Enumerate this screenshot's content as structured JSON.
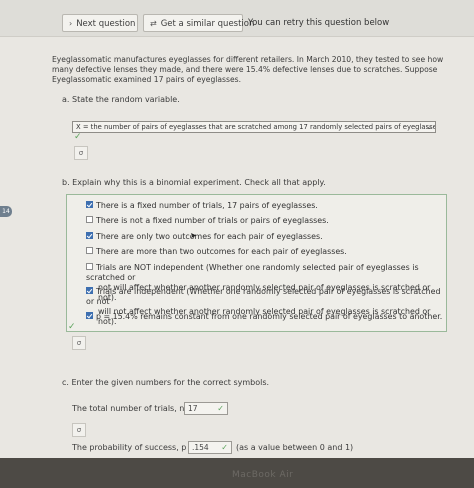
{
  "toolbar": {
    "next_label": "Next question",
    "similar_label": "Get a similar question",
    "retry_text": "You can retry this question below"
  },
  "question": {
    "intro": "Eyeglassomatic manufactures eyeglasses for different retailers. In March 2010, they tested to see how many defective lenses they made, and there were 15.4% defective lenses due to scratches. Suppose Eyeglassomatic examined 17 pairs of eyeglasses."
  },
  "part_a": {
    "label": "a. State the random variable.",
    "selected": "X = the number of pairs of eyeglasses that are scratched among 17 randomly selected pairs of eyeglasses"
  },
  "part_b": {
    "label": "b. Explain why this is a binomial experiment. Check all that apply.",
    "options": [
      {
        "text": "There is a fixed number of trials, 17 pairs of eyeglasses.",
        "checked": true
      },
      {
        "text": "There is not a fixed number of trials or pairs of eyeglasses.",
        "checked": false
      },
      {
        "text": "There are only two outcomes for each pair of eyeglasses.",
        "checked": true
      },
      {
        "text": "There are more than two outcomes for each pair of eyeglasses.",
        "checked": false
      },
      {
        "text": "Trials are NOT independent (Whether one randomly selected pair of eyeglasses is scratched or",
        "text2": "not will affect whether another randomly selected pair of eyeglasses is scratched or not).",
        "checked": false
      },
      {
        "text": "Trials are independent (Whether one randomly selected pair of eyeglasses is scratched or not",
        "text2": "will not affect whether another randomly selected pair of eyeglasses is scratched or not).",
        "checked": true
      },
      {
        "text": "p = 15.4% remains constant from one randomly selected pair of eyeglasses to another.",
        "checked": true
      }
    ]
  },
  "part_c": {
    "label": "c. Enter the given numbers for the correct symbols.",
    "trials_label": "The total number of trials, n =",
    "trials_value": "17",
    "prob_label": "The probability of success, p =",
    "prob_value": ".154",
    "prob_hint": "(as a value between 0 and 1)"
  },
  "misc": {
    "badge": "14",
    "sigma": "σ",
    "brand": "MacBook Air",
    "check": "✓"
  }
}
